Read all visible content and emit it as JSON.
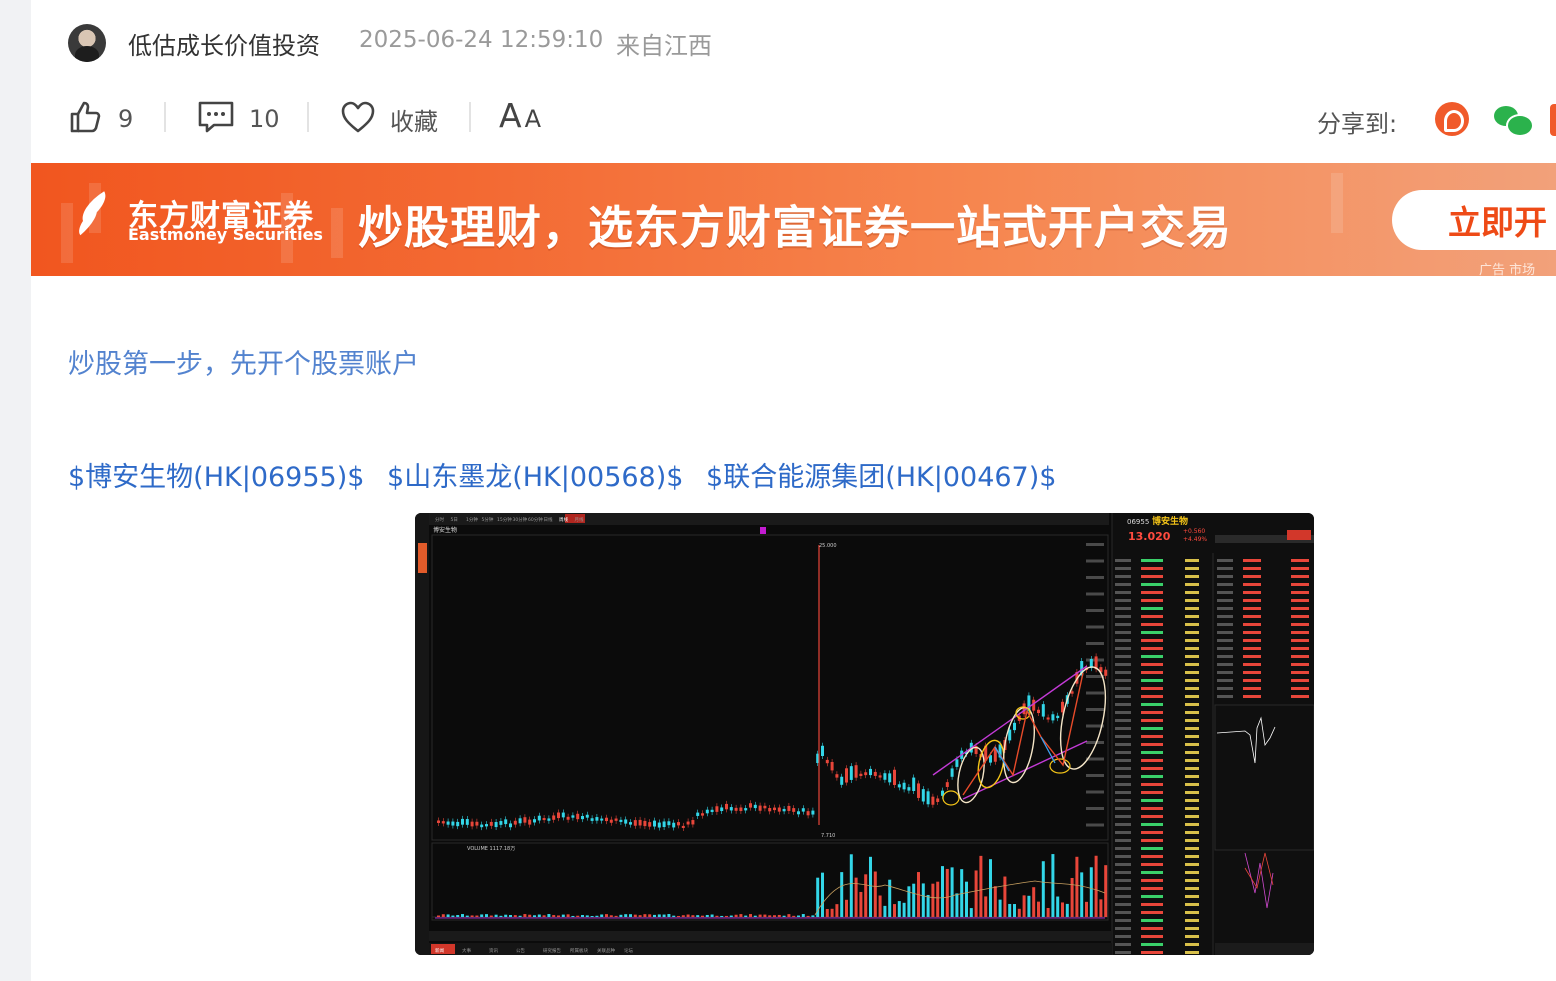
{
  "author": {
    "name": "低估成长价值投资",
    "time": "2025-06-24 12:59:10",
    "location": "来自江西"
  },
  "actions": {
    "like_count": "9",
    "comment_count": "10",
    "favorite_label": "收藏",
    "font_label": "A",
    "font_label_small": "A",
    "share_label": "分享到:"
  },
  "banner": {
    "brand": "东方财富证券",
    "brand_en": "Eastmoney Securities",
    "slogan": "炒股理财，选东方财富证券一站式开户交易",
    "button": "立即开",
    "ad": "广告  市场"
  },
  "content": {
    "promo_link": "炒股第一步，先开个股票账户",
    "stocks": [
      "$博安生物(HK|06955)$",
      "$山东墨龙(HK|00568)$",
      "$联合能源集团(HK|00467)$"
    ]
  },
  "screenshot": {
    "stock_code": "06955",
    "stock_name": "博安生物",
    "price": "13.020",
    "change": "+0.560",
    "change_pct": "+4.49%",
    "chart_label": "博安生物",
    "high_label": "25.000",
    "low_label": "7.710",
    "volume_label": "VOLUME 1117.18万",
    "tabs": [
      "分时",
      "5日",
      "1分钟",
      "5分钟",
      "15分钟",
      "30分钟",
      "60分钟",
      "日线",
      "周线",
      "月线"
    ],
    "bottom_tabs": [
      "新闻",
      "大事",
      "资讯",
      "公告",
      "研究报告",
      "所属板块",
      "关联品种",
      "论坛"
    ],
    "colors": {
      "up": "#e8463a",
      "down": "#33d6e8",
      "bg": "#0b0b0b",
      "accent": "#f5c518"
    }
  }
}
